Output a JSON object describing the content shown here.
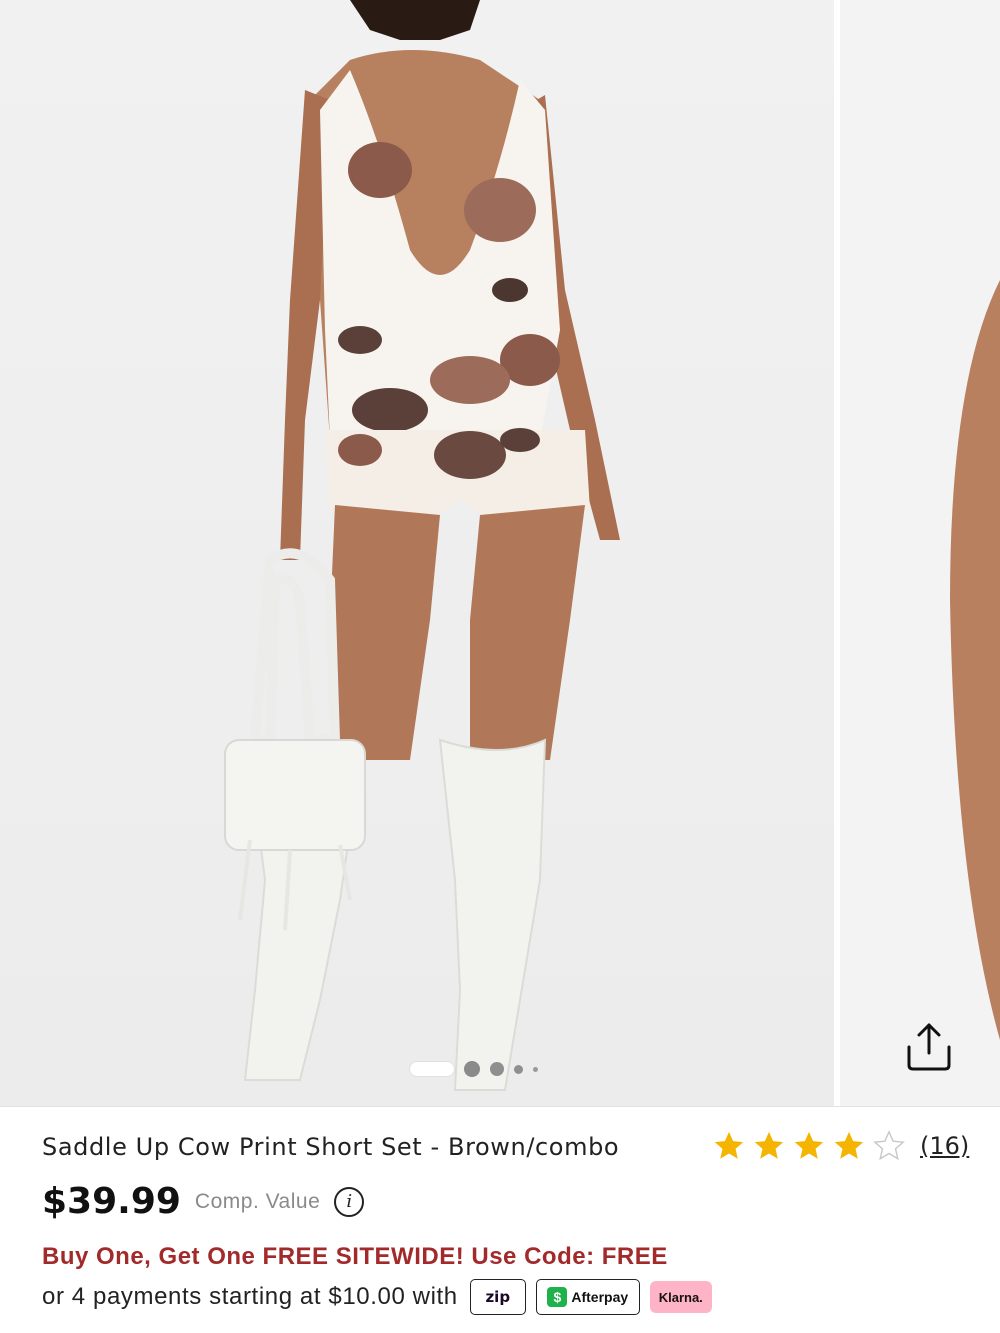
{
  "product": {
    "title": "Saddle Up Cow Print Short Set - Brown/combo",
    "price": "$39.99",
    "comp_value_label": "Comp. Value",
    "info_icon": "info-icon",
    "rating": 4,
    "rating_max": 5,
    "review_count": "(16)"
  },
  "promo": {
    "text": "Buy One, Get One FREE SITEWIDE! Use Code: FREE"
  },
  "payments": {
    "text": "or 4 payments starting at $10.00 with",
    "providers": {
      "zip": "zip",
      "afterpay": "Afterpay",
      "afterpay_symbol": "$",
      "klarna": "Klarna."
    }
  },
  "gallery": {
    "slide_count": 5,
    "active_slide": 1,
    "share_icon": "share-icon"
  },
  "colors": {
    "promo": "#a22a2a",
    "star": "#f5b400",
    "klarna_bg": "#ffb3c7",
    "afterpay_green": "#1fb14a"
  }
}
